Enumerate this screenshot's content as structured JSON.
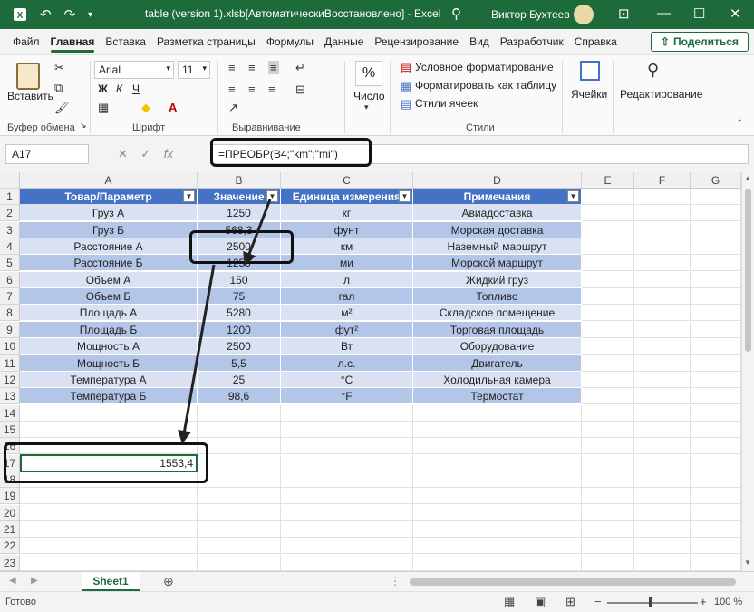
{
  "titlebar": {
    "title": "table (version 1).xlsb[АвтоматическиВосстановлено]  -  Excel",
    "user": "Виктор Бухтеев"
  },
  "tabs": [
    "Файл",
    "Главная",
    "Вставка",
    "Разметка страницы",
    "Формулы",
    "Данные",
    "Рецензирование",
    "Вид",
    "Разработчик",
    "Справка"
  ],
  "share_label": "Поделиться",
  "ribbon": {
    "paste": "Вставить",
    "clipboard": "Буфер обмена",
    "font_name": "Arial",
    "font_size": "11",
    "font": "Шрифт",
    "alignment": "Выравнивание",
    "number": "Число",
    "cond_format": "Условное форматирование",
    "format_table": "Форматировать как таблицу",
    "cell_styles": "Стили ячеек",
    "styles": "Стили",
    "cells": "Ячейки",
    "editing": "Редактирование"
  },
  "formula_bar": {
    "name_box": "A17",
    "formula": "=ПРЕОБР(B4;\"km\";\"mi\")"
  },
  "columns": [
    "A",
    "B",
    "C",
    "D",
    "E",
    "F",
    "G"
  ],
  "table": {
    "headers": [
      "Товар/Параметр",
      "Значение",
      "Единица измерения",
      "Примечания"
    ],
    "rows": [
      [
        "Груз А",
        "1250",
        "кг",
        "Авиадоставка"
      ],
      [
        "Груз Б",
        "568,3",
        "фунт",
        "Морская доставка"
      ],
      [
        "Расстояние А",
        "2500",
        "км",
        "Наземный маршрут"
      ],
      [
        "Расстояние Б",
        "1250",
        "ми",
        "Морской маршрут"
      ],
      [
        "Объем А",
        "150",
        "л",
        "Жидкий груз"
      ],
      [
        "Объем Б",
        "75",
        "гал",
        "Топливо"
      ],
      [
        "Площадь А",
        "5280",
        "м²",
        "Складское помещение"
      ],
      [
        "Площадь Б",
        "1200",
        "фут²",
        "Торговая площадь"
      ],
      [
        "Мощность А",
        "2500",
        "Вт",
        "Оборудование"
      ],
      [
        "Мощность Б",
        "5,5",
        "л.с.",
        "Двигатель"
      ],
      [
        "Температура А",
        "25",
        "°C",
        "Холодильная камера"
      ],
      [
        "Температура Б",
        "98,6",
        "°F",
        "Термостат"
      ]
    ]
  },
  "result_cell": "1553,4",
  "sheet_tab": "Sheet1",
  "status": {
    "ready": "Готово",
    "zoom": "100 %"
  }
}
